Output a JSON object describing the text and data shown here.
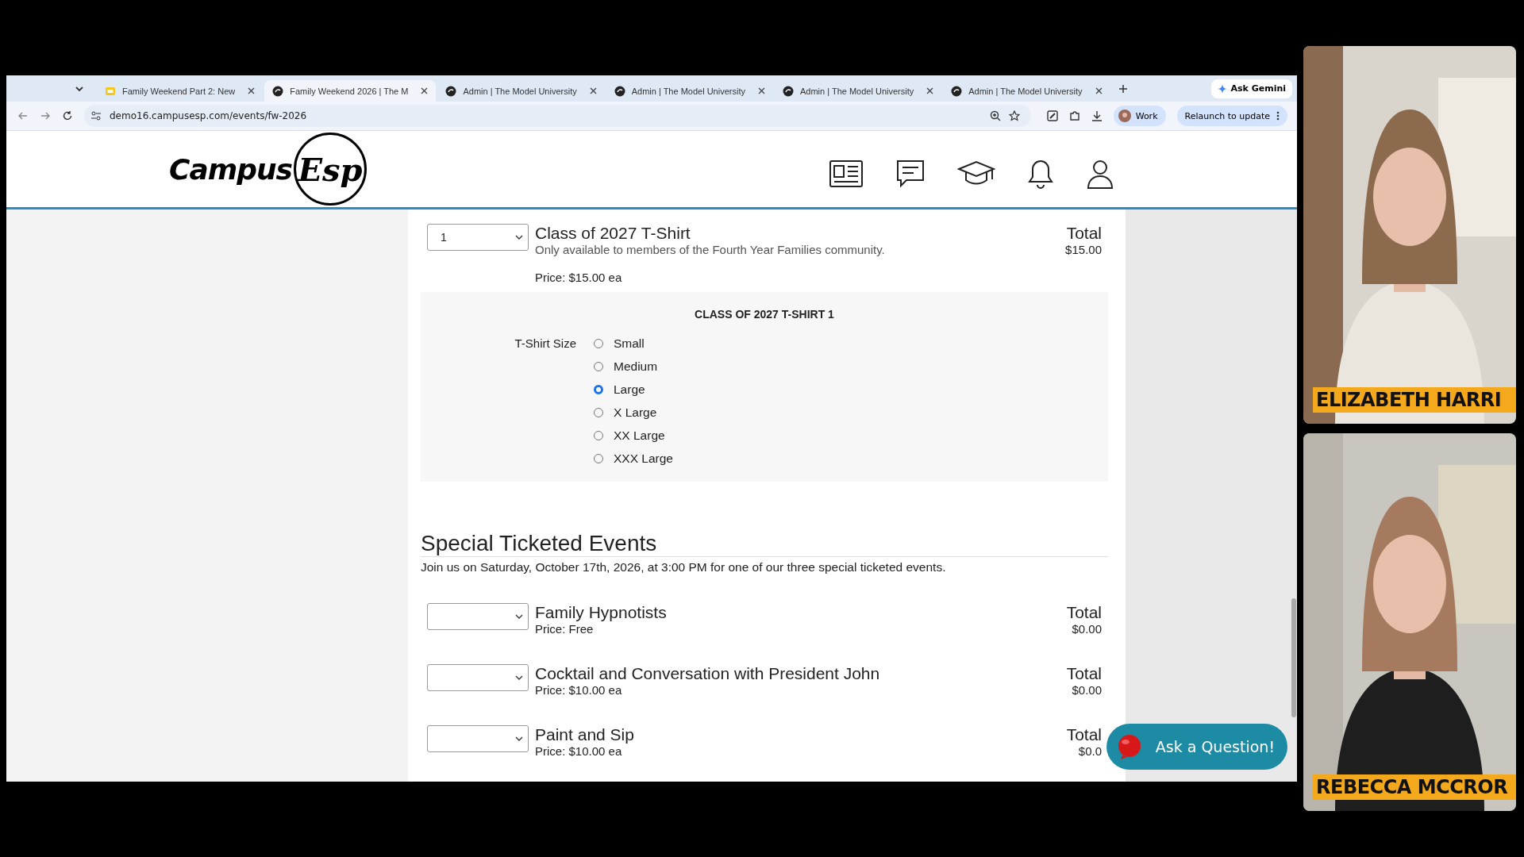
{
  "browser": {
    "tabs": [
      {
        "title": "Family Weekend Part 2: New",
        "kind": "slides",
        "selected": false
      },
      {
        "title": "Family Weekend 2026 | The M",
        "kind": "site",
        "selected": true
      },
      {
        "title": "Admin | The Model University",
        "kind": "site",
        "selected": false
      },
      {
        "title": "Admin | The Model University",
        "kind": "site",
        "selected": false
      },
      {
        "title": "Admin | The Model University",
        "kind": "site",
        "selected": false
      },
      {
        "title": "Admin | The Model University",
        "kind": "site",
        "selected": false
      }
    ],
    "ask_button": "Ask Gemini",
    "address": "demo16.campusesp.com/events/fw-2026",
    "profile": "Work",
    "relaunch": "Relaunch to update"
  },
  "site": {
    "logo": {
      "text": "Campus",
      "mark": "Esp"
    }
  },
  "product": {
    "quantity": "1",
    "title": "Class of 2027 T-Shirt",
    "subtitle": "Only available to members of the Fourth Year Families community.",
    "price": "Price: $15.00 ea",
    "total_label": "Total",
    "total": "$15.00",
    "options": {
      "heading": "CLASS OF 2027 T-SHIRT 1",
      "field_label": "T-Shirt Size",
      "choices": [
        {
          "label": "Small",
          "selected": false
        },
        {
          "label": "Medium",
          "selected": false
        },
        {
          "label": "Large",
          "selected": true
        },
        {
          "label": "X Large",
          "selected": false
        },
        {
          "label": "XX Large",
          "selected": false
        },
        {
          "label": "XXX Large",
          "selected": false
        }
      ]
    }
  },
  "section": {
    "title": "Special Ticketed Events",
    "intro": "Join us on Saturday, October 17th, 2026, at 3:00 PM for one of our three special ticketed events.",
    "events": [
      {
        "name": "Family Hypnotists",
        "price": "Price: Free",
        "total_label": "Total",
        "total": "$0.00"
      },
      {
        "name": "Cocktail and Conversation with President John",
        "price": "Price: $10.00 ea",
        "total_label": "Total",
        "total": "$0.00"
      },
      {
        "name": "Paint and Sip",
        "price": "Price: $10.00 ea",
        "total_label": "Total",
        "total": "$0.0"
      }
    ]
  },
  "chat_button": "Ask a Question!",
  "participants": [
    {
      "name": "ELIZABETH HARRI",
      "kind": "picture"
    },
    {
      "name": "REBECCA MCCROR",
      "kind": "picture"
    }
  ]
}
